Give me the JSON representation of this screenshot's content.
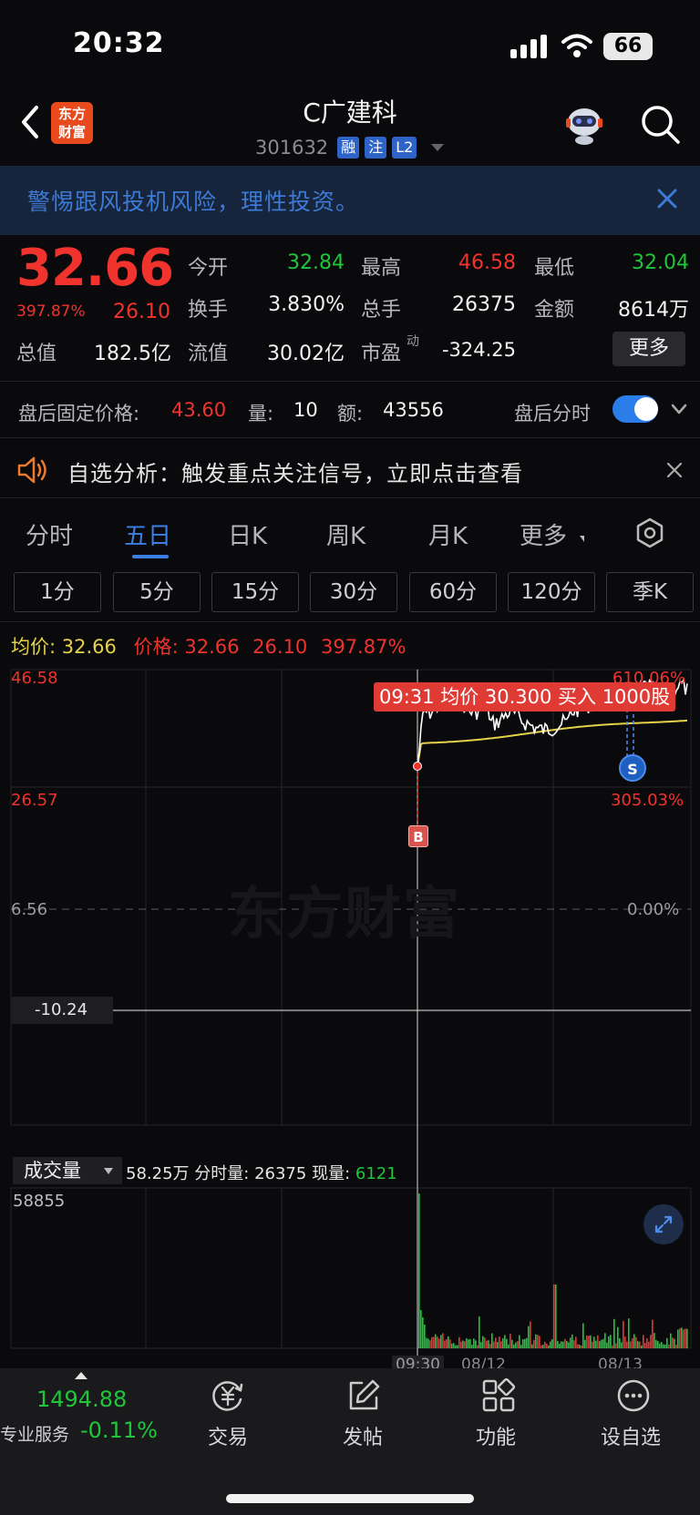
{
  "status_bar": {
    "time": "20:32",
    "battery": "66"
  },
  "header": {
    "title": "C广建科",
    "code": "301632",
    "tags": [
      "融",
      "注",
      "L2"
    ],
    "logo_text": "东方\n财富"
  },
  "warning": {
    "text": "警惕跟风投机风险，理性投资。"
  },
  "quote": {
    "price": "32.66",
    "pct": "397.87%",
    "change": "26.10",
    "open_label": "今开",
    "open": "32.84",
    "high_label": "最高",
    "high": "46.58",
    "low_label": "最低",
    "low": "32.04",
    "turnover_label": "换手",
    "turnover": "3.830%",
    "volume_label": "总手",
    "volume": "26375",
    "amount_label": "金额",
    "amount": "8614万",
    "mktcap_label": "总值",
    "mktcap": "182.5亿",
    "float_label": "流值",
    "float": "30.02亿",
    "pe_label": "市盈",
    "pe_sup": "动",
    "pe": "-324.25",
    "more": "更多"
  },
  "after_hours": {
    "label": "盘后固定价格:",
    "price": "43.60",
    "vol_label": "量:",
    "vol": "10",
    "amt_label": "额:",
    "amt": "43556",
    "toggle_label": "盘后分时",
    "toggle_on": true
  },
  "analysis": {
    "text": "自选分析：触发重点关注信号，立即点击查看"
  },
  "tabs": [
    "分时",
    "五日",
    "日K",
    "周K",
    "月K",
    "更多"
  ],
  "active_tab": "五日",
  "periods": [
    "1分",
    "5分",
    "15分",
    "30分",
    "60分",
    "120分",
    "季K"
  ],
  "legend": {
    "avg_label": "均价:",
    "avg": "32.66",
    "price_label": "价格:",
    "price": "32.66",
    "change": "26.10",
    "pct": "397.87%"
  },
  "chart": {
    "watermark": "东方财富",
    "y_left": [
      "46.58",
      "26.57",
      "6.56",
      "-10.24"
    ],
    "y_right": [
      "610.06%",
      "305.03%",
      "0.00%"
    ],
    "tooltip": "09:31 均价 30.300 买入 1000股",
    "buy_marker": "B",
    "sell_marker": "S",
    "colors": {
      "price_line": "#ffffff",
      "avg_line": "#e6d24a",
      "up": "#f0332d",
      "down": "#1fc63a"
    }
  },
  "volume": {
    "selector": "成交量",
    "total": "58.25万",
    "period_label": "分时量:",
    "period": "26375",
    "current_label": "现量:",
    "current": "6121",
    "max": "58855",
    "time_labels": [
      "09:30",
      "08/12",
      "08/13"
    ]
  },
  "bottom": {
    "index_value": "1494.88",
    "index_label": "专业服务",
    "index_change": "-0.11%",
    "items": [
      "交易",
      "发帖",
      "功能",
      "设自选"
    ]
  }
}
